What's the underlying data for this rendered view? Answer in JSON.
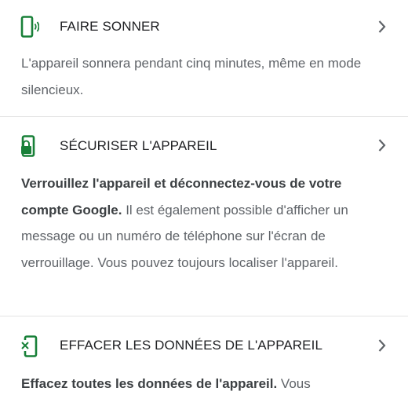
{
  "colors": {
    "accent": "#188038",
    "text": "#202124",
    "muted": "#5f6368",
    "divider": "#e3e3e3"
  },
  "items": [
    {
      "icon": "phone-ring-icon",
      "title": "FAIRE SONNER",
      "desc_bold": "",
      "desc": "L'appareil sonnera pendant cinq minutes, même en mode silencieux."
    },
    {
      "icon": "phone-lock-icon",
      "title": "SÉCURISER L'APPAREIL",
      "desc_bold": "Verrouillez l'appareil et déconnectez-vous de votre compte Google.",
      "desc": " Il est également possible d'afficher un message ou un numéro de téléphone sur l'écran de verrouillage. Vous pouvez toujours localiser l'appareil."
    },
    {
      "icon": "phone-erase-icon",
      "title": "EFFACER LES DONNÉES DE L'APPAREIL",
      "desc_bold": "Effacez toutes les données de l'appareil.",
      "desc": " Vous"
    }
  ]
}
